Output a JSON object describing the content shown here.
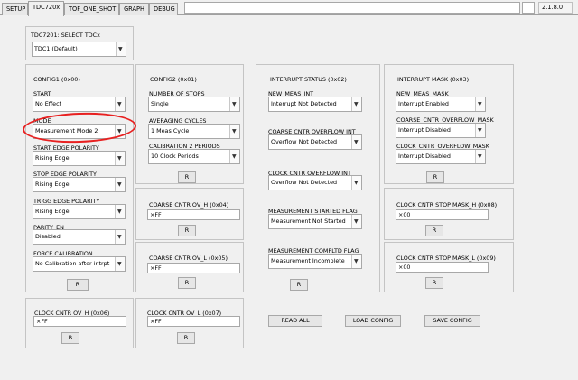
{
  "tabs": [
    {
      "label": "SETUP"
    },
    {
      "label": "TDC720x"
    },
    {
      "label": "TOF_ONE_SHOT"
    },
    {
      "label": "GRAPH"
    },
    {
      "label": "DEBUG"
    }
  ],
  "version": "2.1.8.0",
  "select_tdc": {
    "label": "TDC7201: SELECT TDCx",
    "value": "TDC1 (Default)"
  },
  "config1": {
    "title": "CONFIG1 (0x00)",
    "start": {
      "label": "START",
      "value": "No Effect"
    },
    "mode": {
      "label": "MODE",
      "value": "Measurement Mode 2"
    },
    "start_edge": {
      "label": "START EDGE POLARITY",
      "value": "Rising Edge"
    },
    "stop_edge": {
      "label": "STOP EDGE POLARITY",
      "value": "Rising Edge"
    },
    "trigg_edge": {
      "label": "TRIGG EDGE POLARITY",
      "value": "Rising Edge"
    },
    "parity": {
      "label": "PARITY_EN",
      "value": "Disabled"
    },
    "force_cal": {
      "label": "FORCE CALIBRATION",
      "value": "No Calibration after intrpt"
    },
    "read_label": "R"
  },
  "config2": {
    "title": "CONFIG2 (0x01)",
    "num_stops": {
      "label": "NUMBER OF STOPS",
      "value": "Single"
    },
    "avg_cycles": {
      "label": "AVERAGING CYCLES",
      "value": "1 Meas Cycle"
    },
    "cal2_periods": {
      "label": "CALIBRATION 2 PERIODS",
      "value": "10 Clock Periods"
    },
    "read_label": "R"
  },
  "coarse_ovh": {
    "label": "COARSE CNTR OV_H (0x04)",
    "value": "×FF",
    "read_label": "R"
  },
  "coarse_ovl": {
    "label": "COARSE CNTR OV_L (0x05)",
    "value": "×FF",
    "read_label": "R"
  },
  "clock_ovh": {
    "label": "CLOCK CNTR OV_H (0x06)",
    "value": "×FF",
    "read_label": "R"
  },
  "clock_ovl": {
    "label": "CLOCK CNTR OV_L (0x07)",
    "value": "×FF",
    "read_label": "R"
  },
  "int_status": {
    "title": "INTERRUPT STATUS (0x02)",
    "new_meas": {
      "label": "NEW_MEAS_INT",
      "value": "Interrupt Not Detected"
    },
    "coarse_of": {
      "label": "COARSE CNTR OVERFLOW INT",
      "value": "Overflow Not Detected"
    },
    "clock_of": {
      "label": "CLOCK CNTR OVERFLOW INT",
      "value": "Overflow Not Detected"
    },
    "meas_started": {
      "label": "MEASUREMENT STARTED FLAG",
      "value": "Measurement Not Started"
    },
    "meas_compltd": {
      "label": "MEASUREMENT COMPLTD FLAG",
      "value": "Measurement Incomplete"
    },
    "read_label": "R"
  },
  "int_mask": {
    "title": "INTERRUPT MASK (0x03)",
    "new_meas": {
      "label": "NEW_MEAS_MASK",
      "value": "Interrupt Enabled"
    },
    "coarse_of": {
      "label": "COARSE_CNTR_OVERFLOW_MASK",
      "value": "Interrupt Disabled"
    },
    "clock_of": {
      "label": "CLOCK_CNTR_OVERFLOW_MASK",
      "value": "Interrupt Disabled"
    },
    "read_label": "R"
  },
  "stop_mask_h": {
    "label": "CLOCK CNTR STOP MASK_H (0x08)",
    "value": "×00",
    "read_label": "R"
  },
  "stop_mask_l": {
    "label": "CLOCK CNTR STOP MASK_L (0x09)",
    "value": "×00",
    "read_label": "R"
  },
  "actions": {
    "read_all": "READ ALL",
    "load_config": "LOAD CONFIG",
    "save_config": "SAVE CONFIG"
  },
  "icons": {
    "dropdown": "chevron-down-icon"
  },
  "colors": {
    "annotation": "#e82020"
  }
}
